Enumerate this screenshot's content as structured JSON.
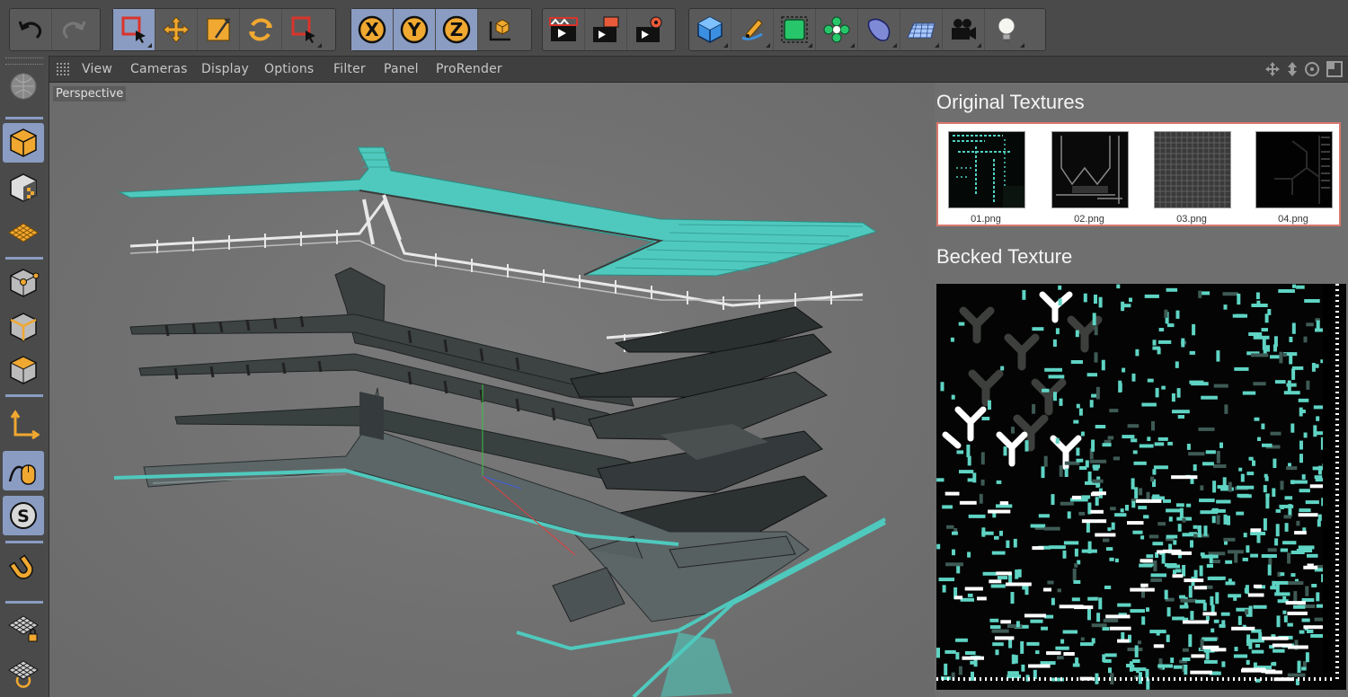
{
  "toolbar": {
    "undo": "undo-icon",
    "redo": "redo-icon",
    "tools": [
      "live-selection-icon",
      "move-icon",
      "scale-icon",
      "rotate-icon",
      "recent-tool-icon"
    ],
    "axes": [
      "X",
      "Y",
      "Z"
    ],
    "coordinate": "coordinate-system-icon",
    "render": [
      "render-view-icon",
      "render-picture-viewer-icon",
      "render-settings-icon"
    ],
    "objects": [
      "cube-icon",
      "pen-icon",
      "subdivision-icon",
      "cloner-icon",
      "deformer-icon",
      "floor-icon",
      "camera-icon",
      "light-icon"
    ]
  },
  "menu": [
    "View",
    "Cameras",
    "Display",
    "Options",
    "Filter",
    "Panel",
    "ProRender"
  ],
  "viewport": {
    "label": "Perspective"
  },
  "panel": {
    "original_title": "Original Textures",
    "thumbnails": [
      "01.png",
      "02.png",
      "03.png",
      "04.png"
    ],
    "baked_title": "Becked Texture"
  },
  "colors": {
    "accent": "#5fd4c4",
    "toolbar_active": "#8a9cc2",
    "icon_orange": "#f0a830"
  }
}
